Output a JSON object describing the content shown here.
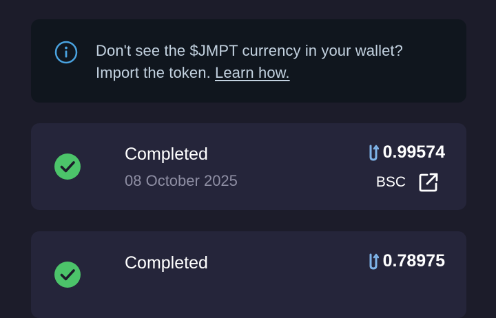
{
  "notice": {
    "line1": "Don't see the $JMPT currency in your wallet?",
    "line2_prefix": "Import the token. ",
    "link": "Learn how."
  },
  "transactions": [
    {
      "status": "Completed",
      "date": "08 October 2025",
      "amount": "0.99574",
      "network": "BSC"
    },
    {
      "status": "Completed",
      "date": "",
      "amount": "0.78975",
      "network": ""
    }
  ],
  "colors": {
    "background": "#1c1c2a",
    "card": "#25253a",
    "notice_bg": "#10161e",
    "info_icon": "#4aa3e0",
    "success": "#4cc46a",
    "muted_text": "#8e8ea3",
    "token_icon": "#7fb4e8"
  },
  "icons": {
    "info": "info-circle-icon",
    "status": "check-circle-icon",
    "token": "jmpt-token-icon",
    "external": "external-link-icon"
  }
}
